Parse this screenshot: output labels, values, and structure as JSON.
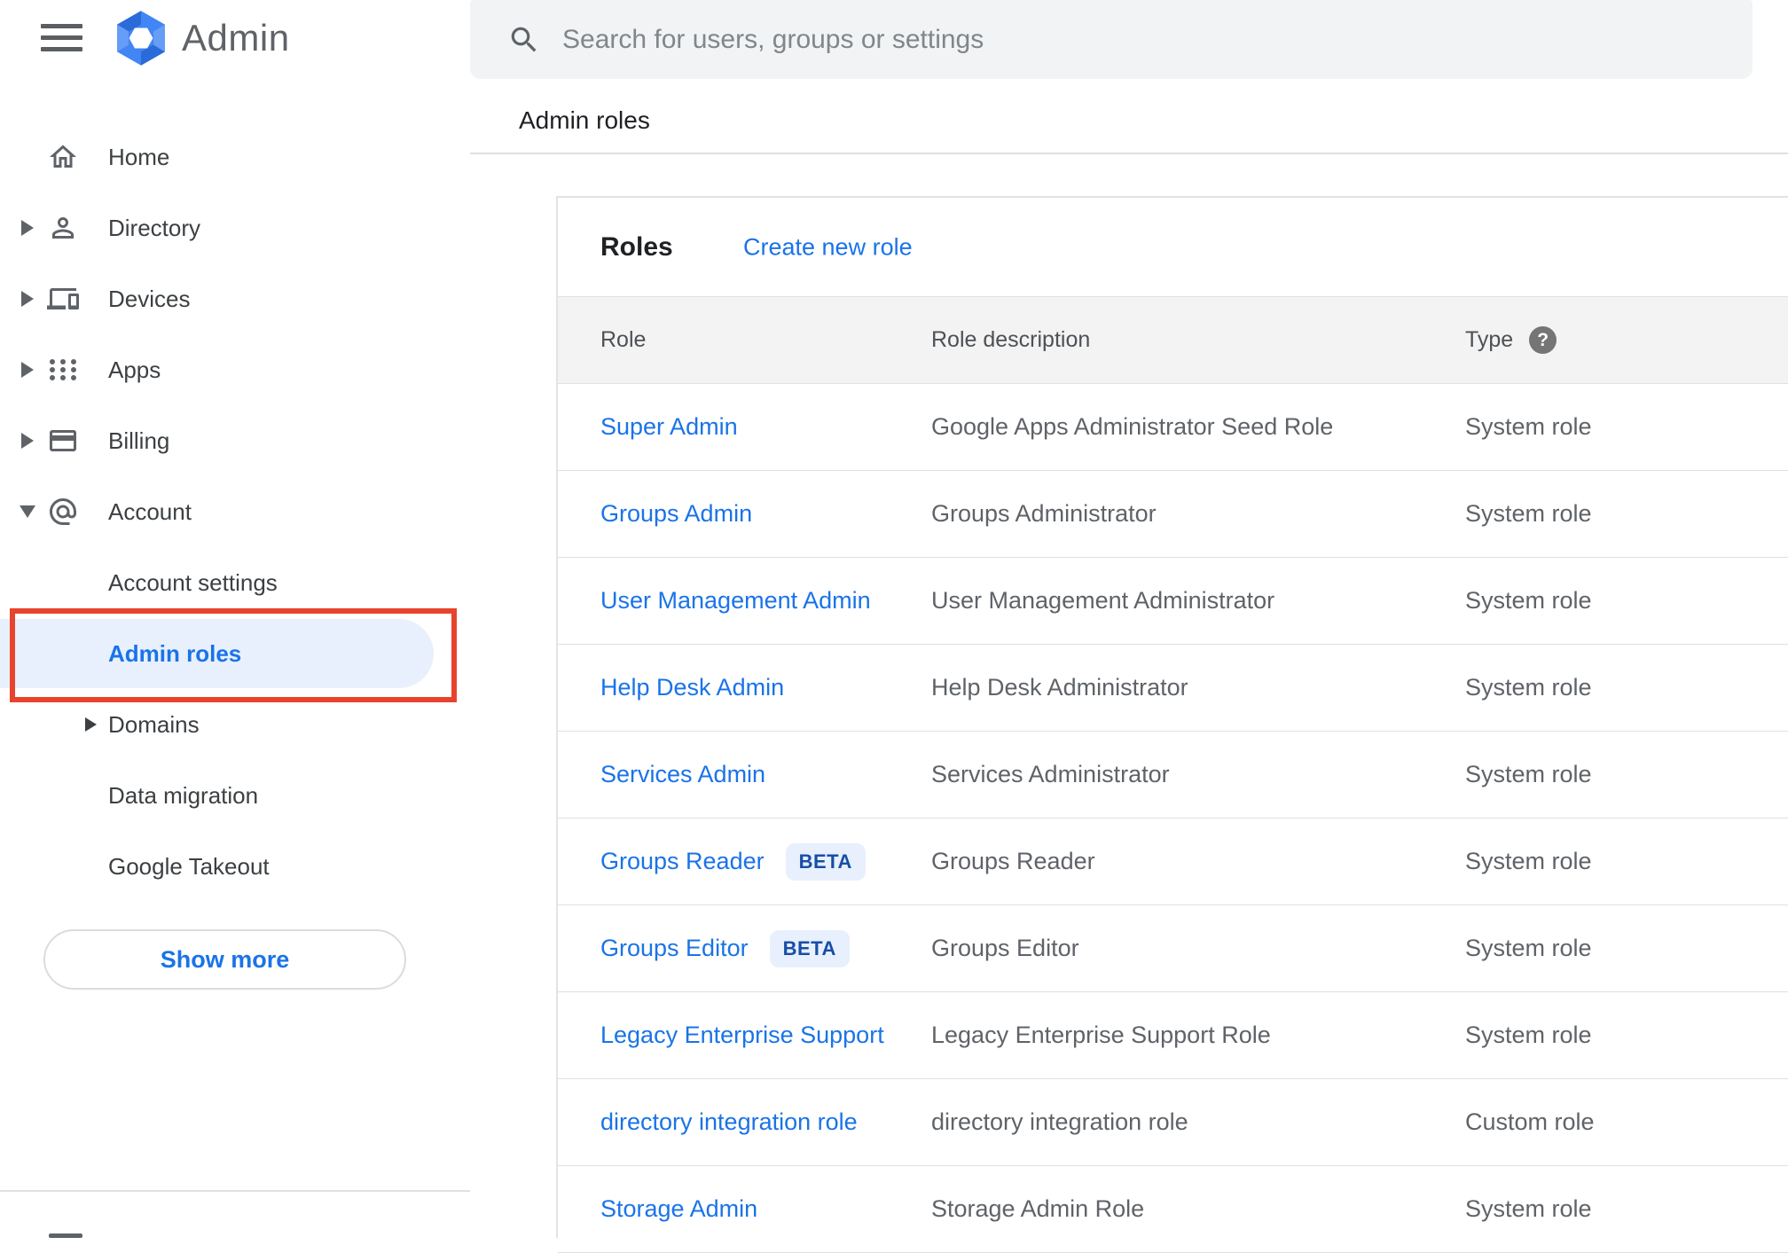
{
  "header": {
    "app_name": "Admin",
    "search_placeholder": "Search for users, groups or settings"
  },
  "breadcrumb": "Admin roles",
  "sidebar": {
    "items": [
      {
        "label": "Home",
        "icon": "home-icon",
        "expandable": false
      },
      {
        "label": "Directory",
        "icon": "person-icon",
        "expandable": true
      },
      {
        "label": "Devices",
        "icon": "devices-icon",
        "expandable": true
      },
      {
        "label": "Apps",
        "icon": "apps-grid-icon",
        "expandable": true
      },
      {
        "label": "Billing",
        "icon": "credit-card-icon",
        "expandable": true
      },
      {
        "label": "Account",
        "icon": "at-sign-icon",
        "expandable": true,
        "expanded": true
      }
    ],
    "account_subitems": [
      {
        "label": "Account settings",
        "selected": false,
        "expandable": false
      },
      {
        "label": "Admin roles",
        "selected": true,
        "expandable": false,
        "annotated": true
      },
      {
        "label": "Domains",
        "selected": false,
        "expandable": true
      },
      {
        "label": "Data migration",
        "selected": false,
        "expandable": false
      },
      {
        "label": "Google Takeout",
        "selected": false,
        "expandable": false
      }
    ],
    "show_more_label": "Show more"
  },
  "main": {
    "card_title": "Roles",
    "create_link": "Create new role",
    "table": {
      "columns": [
        "Role",
        "Role description",
        "Type"
      ],
      "help_icon_glyph": "?",
      "beta_label": "BETA",
      "rows": [
        {
          "role": "Super Admin",
          "beta": false,
          "description": "Google Apps Administrator Seed Role",
          "type": "System role"
        },
        {
          "role": "Groups Admin",
          "beta": false,
          "description": "Groups Administrator",
          "type": "System role"
        },
        {
          "role": "User Management Admin",
          "beta": false,
          "description": "User Management Administrator",
          "type": "System role"
        },
        {
          "role": "Help Desk Admin",
          "beta": false,
          "description": "Help Desk Administrator",
          "type": "System role"
        },
        {
          "role": "Services Admin",
          "beta": false,
          "description": "Services Administrator",
          "type": "System role"
        },
        {
          "role": "Groups Reader",
          "beta": true,
          "description": "Groups Reader",
          "type": "System role"
        },
        {
          "role": "Groups Editor",
          "beta": true,
          "description": "Groups Editor",
          "type": "System role"
        },
        {
          "role": "Legacy Enterprise Support",
          "beta": false,
          "description": "Legacy Enterprise Support Role",
          "type": "System role"
        },
        {
          "role": "directory integration role",
          "beta": false,
          "description": "directory integration role",
          "type": "Custom role"
        },
        {
          "role": "Storage Admin",
          "beta": false,
          "description": "Storage Admin Role",
          "type": "System role"
        }
      ]
    }
  },
  "colors": {
    "accent_blue": "#1a73e8",
    "beta_text": "#174ea6",
    "beta_bg": "#e8f0fe",
    "selected_bg": "#e8f0fe",
    "annotation_red": "#e8432c",
    "search_bg": "#f1f3f4",
    "table_header_bg": "#f2f3f2",
    "divider": "#e0e0e0",
    "icon_gray": "#5f6368"
  }
}
